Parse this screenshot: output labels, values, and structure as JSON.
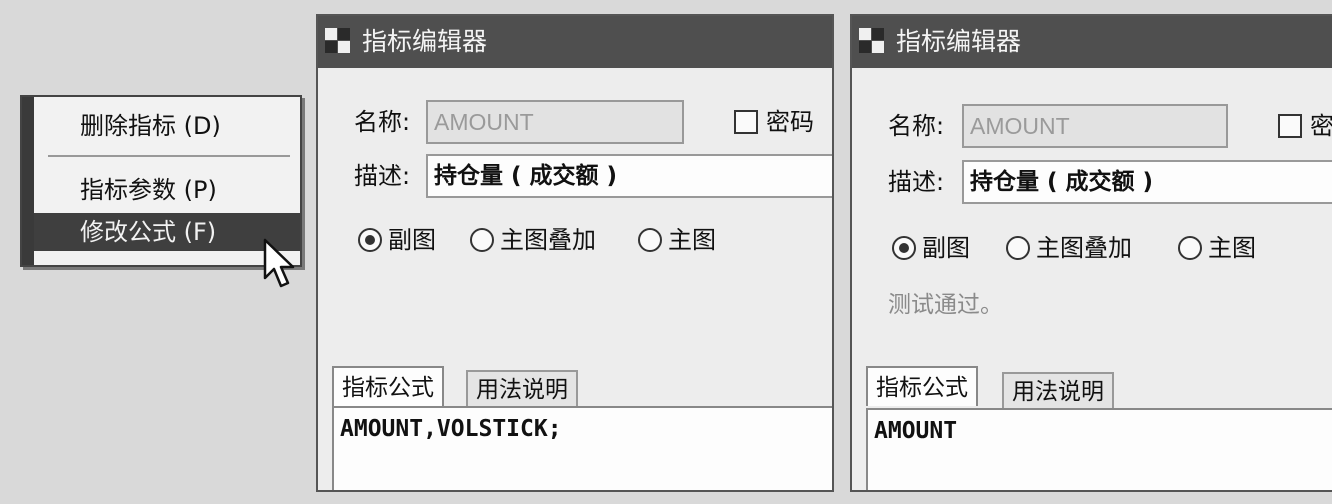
{
  "context_menu": {
    "items": [
      {
        "label": "删除指标 (D)"
      },
      {
        "label": "指标参数 (P)"
      },
      {
        "label": "修改公式 (F)"
      }
    ]
  },
  "dialogs": [
    {
      "title": "指标编辑器",
      "name_label": "名称:",
      "name_value": "AMOUNT",
      "password_label": "密码",
      "desc_label": "描述:",
      "desc_value": "持仓量 ( 成交额 )",
      "radios": [
        {
          "label": "副图",
          "checked": true
        },
        {
          "label": "主图叠加",
          "checked": false
        },
        {
          "label": "主图",
          "checked": false
        }
      ],
      "status": "",
      "tabs": [
        {
          "label": "指标公式",
          "active": true
        },
        {
          "label": "用法说明",
          "active": false
        }
      ],
      "formula": "AMOUNT,VOLSTICK;"
    },
    {
      "title": "指标编辑器",
      "name_label": "名称:",
      "name_value": "AMOUNT",
      "password_label": "密",
      "desc_label": "描述:",
      "desc_value": "持仓量 ( 成交额 )",
      "radios": [
        {
          "label": "副图",
          "checked": true
        },
        {
          "label": "主图叠加",
          "checked": false
        },
        {
          "label": "主图",
          "checked": false
        }
      ],
      "status": "测试通过。",
      "tabs": [
        {
          "label": "指标公式",
          "active": true
        },
        {
          "label": "用法说明",
          "active": false
        }
      ],
      "formula": "AMOUNT"
    }
  ],
  "icons": {
    "window": "window-icon",
    "cursor": "mouse-pointer-icon"
  },
  "colors": {
    "titlebar": "#4f4f4f",
    "highlight": "#3f3f3f",
    "background": "#d9d9d9"
  }
}
